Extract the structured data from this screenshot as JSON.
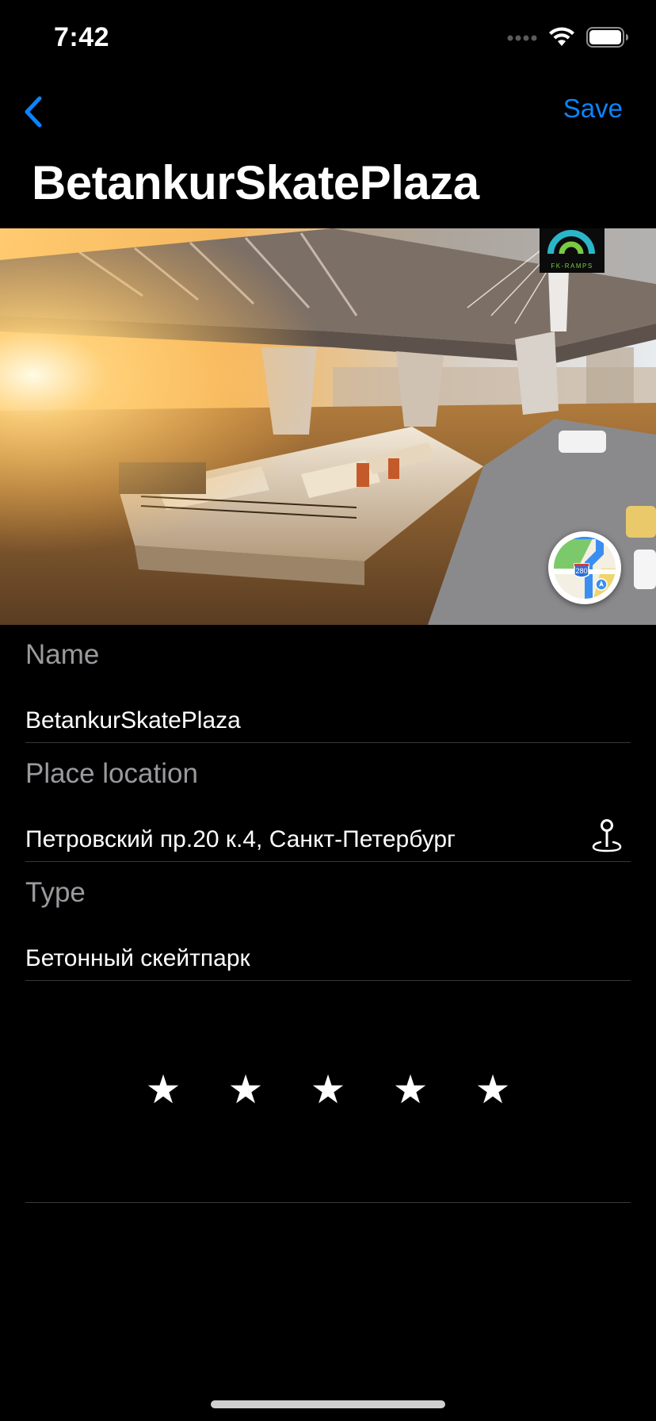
{
  "status_bar": {
    "time": "7:42"
  },
  "nav": {
    "save_label": "Save",
    "title": "BetankurSkatePlaza"
  },
  "hero": {
    "logo_text": "FK-RAMPS",
    "shield_number": "280"
  },
  "form": {
    "name": {
      "label": "Name",
      "value": "BetankurSkatePlaza"
    },
    "location": {
      "label": "Place location",
      "value": "Петровский пр.20 к.4, Санкт-Петербург"
    },
    "type": {
      "label": "Type",
      "value": "Бетонный скейтпарк"
    }
  },
  "rating": {
    "value": 5,
    "max": 5,
    "star_glyph": "★"
  },
  "colors": {
    "accent": "#0a84ff",
    "background": "#000000",
    "label": "#9a9a9e",
    "separator": "#38383a"
  }
}
